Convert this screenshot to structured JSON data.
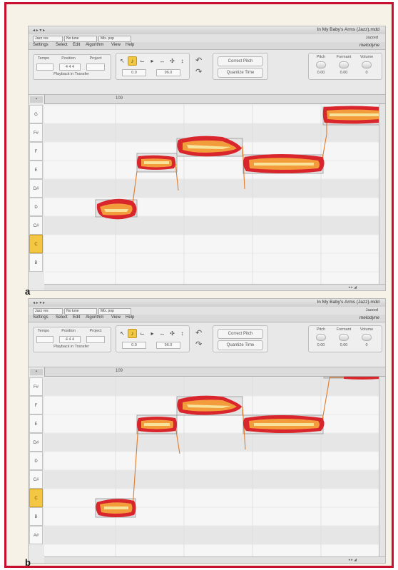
{
  "window": {
    "title": "In My Baby's Arms (Jazz).mdd",
    "controls": "◂ ▸ ▾ ▸"
  },
  "toolbar": {
    "select_1": "Jazz res",
    "select_2": "No tune",
    "select_3": "Mix. pop",
    "sync_label": "Jazzed"
  },
  "menu": [
    "Settings",
    "Select",
    "Edit",
    "Algorithm",
    "View",
    "Help"
  ],
  "brand": "melodyne",
  "transport": {
    "tempo_label": "Tempo",
    "position_label": "Position",
    "position_value": "4 4 4",
    "project_label": "Project",
    "playback_label": "Playback in Transfer"
  },
  "tools": {
    "icons": [
      "arrow-tool",
      "pitch-tool",
      "formant-tool",
      "amplitude-tool",
      "time-tool",
      "separation-tool",
      "pitch-drift-tool"
    ],
    "glyphs": [
      "↖",
      "♪",
      "⌙",
      "▸",
      "↔",
      "✣",
      "↕"
    ],
    "field_1": "0.0",
    "field_2": "96.0"
  },
  "actions": {
    "correct_pitch": "Correct Pitch",
    "quantize_time": "Quantize Time"
  },
  "macros": {
    "labels": [
      "Pitch",
      "Formant",
      "Volume"
    ],
    "values": [
      "0.00",
      "0.00",
      "0"
    ]
  },
  "panel_a": {
    "letter": "a",
    "bar_number": "109",
    "keys": [
      "G",
      "F#",
      "F",
      "E",
      "D#",
      "D",
      "C#",
      "C",
      "B"
    ],
    "selected_key": "C"
  },
  "panel_b": {
    "letter": "b",
    "bar_number": "109",
    "keys": [
      "F#",
      "F",
      "E",
      "D#",
      "D",
      "C#",
      "C",
      "B",
      "A#"
    ],
    "selected_key": "C"
  },
  "colors": {
    "frame_border": "#c8102e",
    "blob_outer": "#d9262c",
    "blob_inner": "#f39c3c",
    "blob_core": "#f7e39a",
    "pitch_line": "#e07a2a",
    "key_selected": "#f3c743"
  }
}
